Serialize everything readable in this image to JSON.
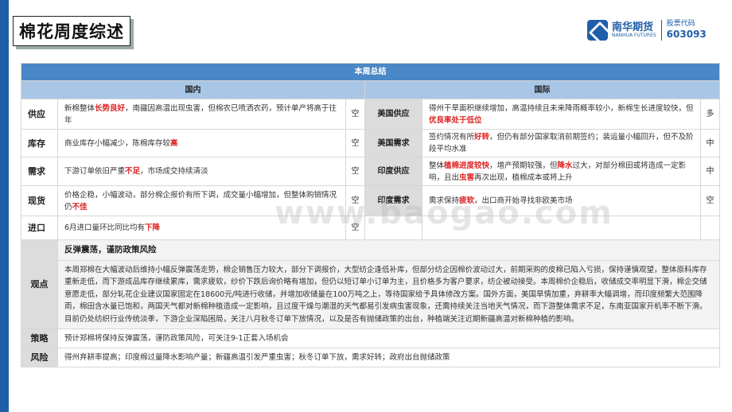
{
  "header": {
    "title": "棉花周度综述",
    "logo_cn": "南华期货",
    "logo_en": "NANHUA FUTURES",
    "stock_label": "股票代码",
    "stock_code": "603093"
  },
  "table": {
    "summary_title": "本周总结",
    "domestic_header": "国内",
    "international_header": "国际",
    "rows": [
      {
        "label": "供应",
        "domestic": [
          "新棉整体",
          {
            "red": "长势良好"
          },
          "，南疆因高温出现虫害，但棉农已喷洒农药，预计单产将高于往年"
        ],
        "domestic_signal": "空",
        "intl_label": "美国供应",
        "intl": [
          "得州干旱面积继续增加，高温持续且未来降雨概率较小，新棉生长进度较快，但",
          {
            "red": "优良率处于低位"
          }
        ],
        "intl_signal": "多"
      },
      {
        "label": "库存",
        "domestic": [
          "商业库存小幅减少，陈棉库存较",
          {
            "red": "高"
          }
        ],
        "domestic_signal": "空",
        "intl_label": "美国需求",
        "intl": [
          "签约情况有所",
          {
            "red": "好转"
          },
          "，但仍有部分国家取消前期签约；装运量小幅回升，但不及阶段平均水准"
        ],
        "intl_signal": "中"
      },
      {
        "label": "需求",
        "domestic": [
          "下游订单依旧严重",
          {
            "red": "不足"
          },
          "，市场成交持续清淡"
        ],
        "domestic_signal": "空",
        "intl_label": "印度供应",
        "intl": [
          "整体",
          {
            "red": "植棉进度较快"
          },
          "，增产预期较强，但",
          {
            "red": "降水"
          },
          "过大，对部分棉田或将造成一定影响，且出",
          {
            "red": "虫害"
          },
          "再次出现，植棉成本或将上升"
        ],
        "intl_signal": "中"
      },
      {
        "label": "现货",
        "domestic": [
          "价格企稳，小幅波动，部分棉企报价有所下调，成交量小幅增加，但整体购销情况仍",
          {
            "red": "不佳"
          }
        ],
        "domestic_signal": "空",
        "intl_label": "印度需求",
        "intl": [
          "需求保持",
          {
            "red": "疲软"
          },
          "，出口商开始寻找非欧美市场"
        ],
        "intl_signal": "空"
      },
      {
        "label": "进口",
        "domestic": [
          "6月进口量环比同比均有",
          {
            "red": "下降"
          }
        ],
        "domestic_signal": "空"
      }
    ],
    "view_label": "观点",
    "view_title": "反弹震荡，谨防政策风险",
    "view_text": "本周郑棉在大幅波动后维持小幅反弹震荡走势，棉企销售压力较大，部分下调报价，大型纺企逢低补库，但部分纺企因棉价波动过大，前期采购的皮棉已陷入亏损，保持谨慎观望，整体原料库存重新走低，而下游成品库存继续累库，需求疲软，纱价下跌后询价略有增加，但仍以短订单小订单为主，且价格多为客户要求，纺企被动接受。本周棉价企稳后，收储成交率明显下滑，棉企交储意愿走低，部分轧花企业建议国家固定在18600元/吨进行收储，并增加收储量在100万吨之上，等待国家给予具体修改方案。国外方面，美国旱情加重，弃耕率大幅调增，而印度频繁大范围降雨，棉田含水量已饱和，两国天气都对新棉种植造成一定影响，且过度干燥与潮湿的天气都易引发病虫害现象，还需持续关注当地天气情况，而下游整体需求不足，东南亚国家开机率不断下滑。目前仍处纺织行业传统淡季，下游企业深陷困局，关注八月秋冬订单下放情况，以及是否有抛储政策的出台，种植端关注近期新疆高温对新棉种植的影响。",
    "strategy_label": "策略",
    "strategy_text": "预计郑棉将保持反弹震荡，谨防政策风险，可关注9-1正套入场机会",
    "risk_label": "风险",
    "risk_text": "得州弃耕率提高；印度棉过量降水影响产量；新疆高温引发严重虫害；秋冬订单下放，需求好转；政府出台抛储政策"
  },
  "watermark": "www.baogao.com"
}
